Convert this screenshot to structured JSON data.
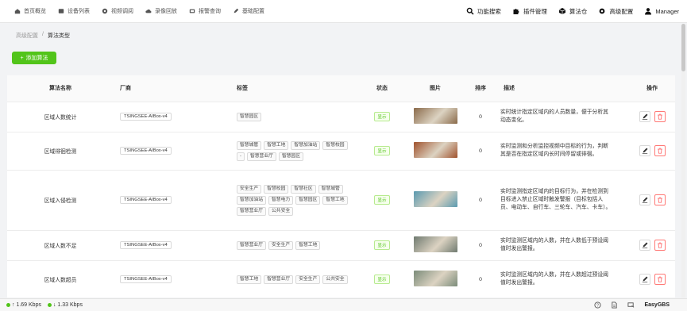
{
  "nav": {
    "left": [
      {
        "label": "首页概览",
        "icon": "home-icon"
      },
      {
        "label": "设备列表",
        "icon": "device-list-icon"
      },
      {
        "label": "视频调阅",
        "icon": "video-icon"
      },
      {
        "label": "录像回放",
        "icon": "cloud-playback-icon"
      },
      {
        "label": "报警查询",
        "icon": "alarm-icon"
      },
      {
        "label": "基础配置",
        "icon": "edit-config-icon"
      }
    ],
    "right": [
      {
        "label": "功能搜索",
        "icon": "search-icon"
      },
      {
        "label": "插件管理",
        "icon": "puzzle-icon"
      },
      {
        "label": "算法仓",
        "icon": "algorithm-store-icon"
      },
      {
        "label": "高级配置",
        "icon": "gear-icon"
      },
      {
        "label": "Manager",
        "icon": "user-icon"
      }
    ]
  },
  "breadcrumb": {
    "parent": "高级配置",
    "sep": "/",
    "current": "算法类型"
  },
  "add_button": {
    "icon": "+",
    "label": "添加算法"
  },
  "table": {
    "headers": {
      "name": "算法名称",
      "vendor": "厂商",
      "tags": "标签",
      "status": "状态",
      "image": "图片",
      "order": "排序",
      "desc": "描述",
      "ops": "操作"
    },
    "rows": [
      {
        "name": "区域人数统计",
        "vendor": "TSINGSEE-AIBox-v4",
        "tags": [
          "智慧园区"
        ],
        "status": "显示",
        "order": "0",
        "desc": "实时统计指定区域内的人员数量，便于分析其动态变化。",
        "thumb_color": "#8a6a4a"
      },
      {
        "name": "区域徘徊检测",
        "vendor": "TSINGSEE-AIBox-v4",
        "tags": [
          "智慧城管",
          "智慧工地",
          "智慧加油站",
          "智慧校园",
          "-",
          "智慧营业厅",
          "智慧园区"
        ],
        "status": "显示",
        "order": "0",
        "desc": "实时监测和分析监控视频中目标的行为，判断其是否在指定区域内长时间停留或徘徊。",
        "thumb_color": "#a0522d"
      },
      {
        "name": "区域入侵检测",
        "vendor": "TSINGSEE-AIBox-v4",
        "tags": [
          "安全生产",
          "智慧校园",
          "智慧社区",
          "智慧城管",
          "智慧加油站",
          "智慧电力",
          "智慧园区",
          "智慧工地",
          "智慧营业厅",
          "公共安全"
        ],
        "status": "显示",
        "order": "0",
        "desc": "实时监测指定区域内的目标行为，并在检测到目标进入禁止区域时触发警报（目标包括人员、电动车、自行车、三轮车、汽车、卡车）。",
        "thumb_color": "#5a9ab0"
      },
      {
        "name": "区域人数不足",
        "vendor": "TSINGSEE-AIBox-v4",
        "tags": [
          "智慧营业厅",
          "安全生产",
          "智慧工地"
        ],
        "status": "显示",
        "order": "0",
        "desc": "实时监测区域内的人数，并在人数低于预设阈值时发出警报。",
        "thumb_color": "#6f7a70"
      },
      {
        "name": "区域人数超员",
        "vendor": "TSINGSEE-AIBox-v4",
        "tags": [
          "智慧工地",
          "智慧营业厅",
          "安全生产",
          "公共安全"
        ],
        "status": "显示",
        "order": "0",
        "desc": "实时监测区域内的人数，并在人数超过预设阈值时发出警报。",
        "thumb_color": "#7b8c7a"
      }
    ]
  },
  "footer": {
    "upload": "↑ 1.69 Kbps",
    "download": "↓ 1.33 Kbps",
    "brand": "EasyGBS"
  }
}
